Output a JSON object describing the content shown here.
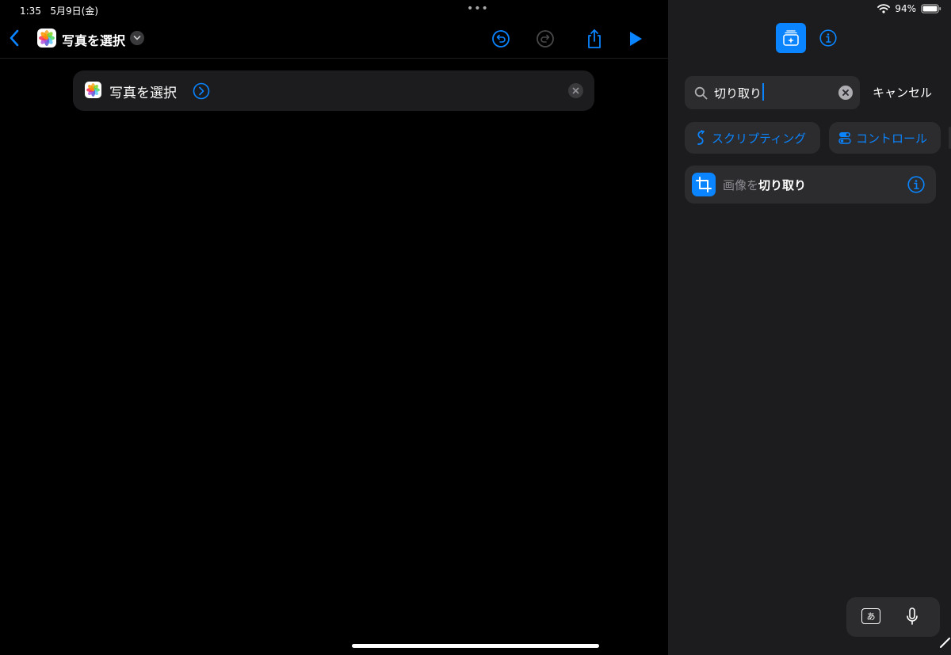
{
  "status_bar": {
    "time": "1:35",
    "date": "5月9日(金)",
    "battery": "94%"
  },
  "toolbar": {
    "shortcut_title": "写真を選択"
  },
  "action": {
    "label": "写真を選択"
  },
  "search": {
    "value": "切り取り",
    "cancel_label": "キャンセル"
  },
  "categories": [
    {
      "label": "スクリプティング",
      "icon": "scripting-icon"
    },
    {
      "label": "コントロール",
      "icon": "control-icon"
    }
  ],
  "results": [
    {
      "prefix": "画像を",
      "match": "切り取り",
      "icon": "crop-icon"
    }
  ],
  "keyboard": {
    "input_mode_label": "あ"
  },
  "colors": {
    "accent": "#0a84ff",
    "panel": "#1c1c1e",
    "field": "#2c2c2e"
  }
}
